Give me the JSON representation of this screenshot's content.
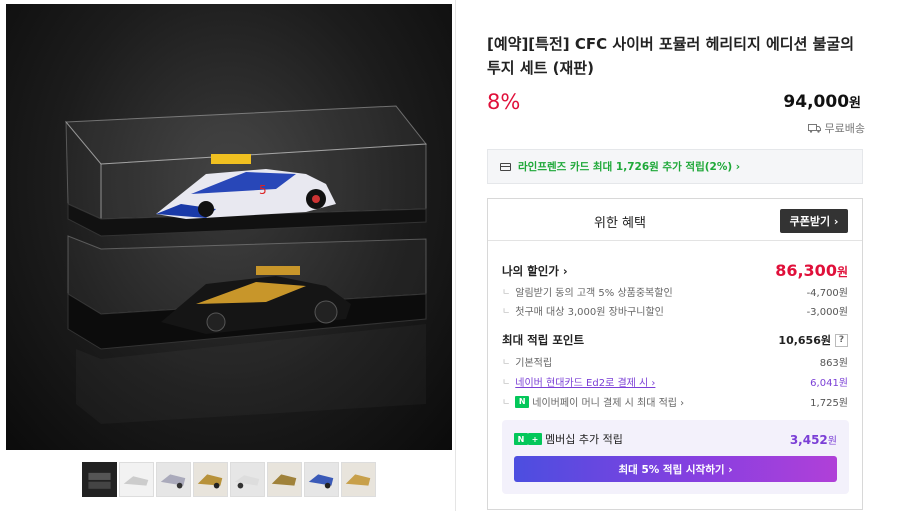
{
  "product": {
    "title": "[예약][특전] CFC 사이버 포뮬러 헤리티지 에디션 불굴의 투지 세트 (재판)",
    "discount_rate": "8%",
    "price": "94,000",
    "price_unit": "원",
    "shipping": "무료배송"
  },
  "card_banner": {
    "text": "라인프렌즈 카드 최대 1,726원 추가 적립(2%) ›"
  },
  "benefits": {
    "title": "위한 혜택",
    "coupon_button": "쿠폰받기 ›",
    "my_price_label": "나의 할인가 ›",
    "my_price_value": "86,300",
    "my_price_unit": "원",
    "discount_items": [
      {
        "label": "알림받기 동의 고객 5% 상품중복할인",
        "value": "-4,700원"
      },
      {
        "label": "첫구매 대상 3,000원 장바구니할인",
        "value": "-3,000원"
      }
    ],
    "points_label": "최대 적립 포인트",
    "points_value": "10,656원",
    "points_help": "?",
    "point_items": [
      {
        "label": "기본적립",
        "value": "863원"
      },
      {
        "label": "네이버 현대카드 Ed2로 결제 시 ›",
        "value": "6,041원"
      },
      {
        "label": "네이버페이 머니 결제 시 최대 적립 ›",
        "value": "1,725원"
      }
    ],
    "membership_label": "멤버십 추가 적립",
    "membership_value": "3,452",
    "membership_unit": "원",
    "membership_button": "최대 5% 적립 시작하기 ›",
    "npay_badge": "N",
    "plus_badge": "+"
  },
  "gallery": {
    "thumbnail_count": 8,
    "active_index": 0
  },
  "colors": {
    "accent_red": "#e0103a",
    "accent_purple": "#7b3fd6",
    "npay_green": "#03c75a",
    "card_green": "#1ea838"
  }
}
